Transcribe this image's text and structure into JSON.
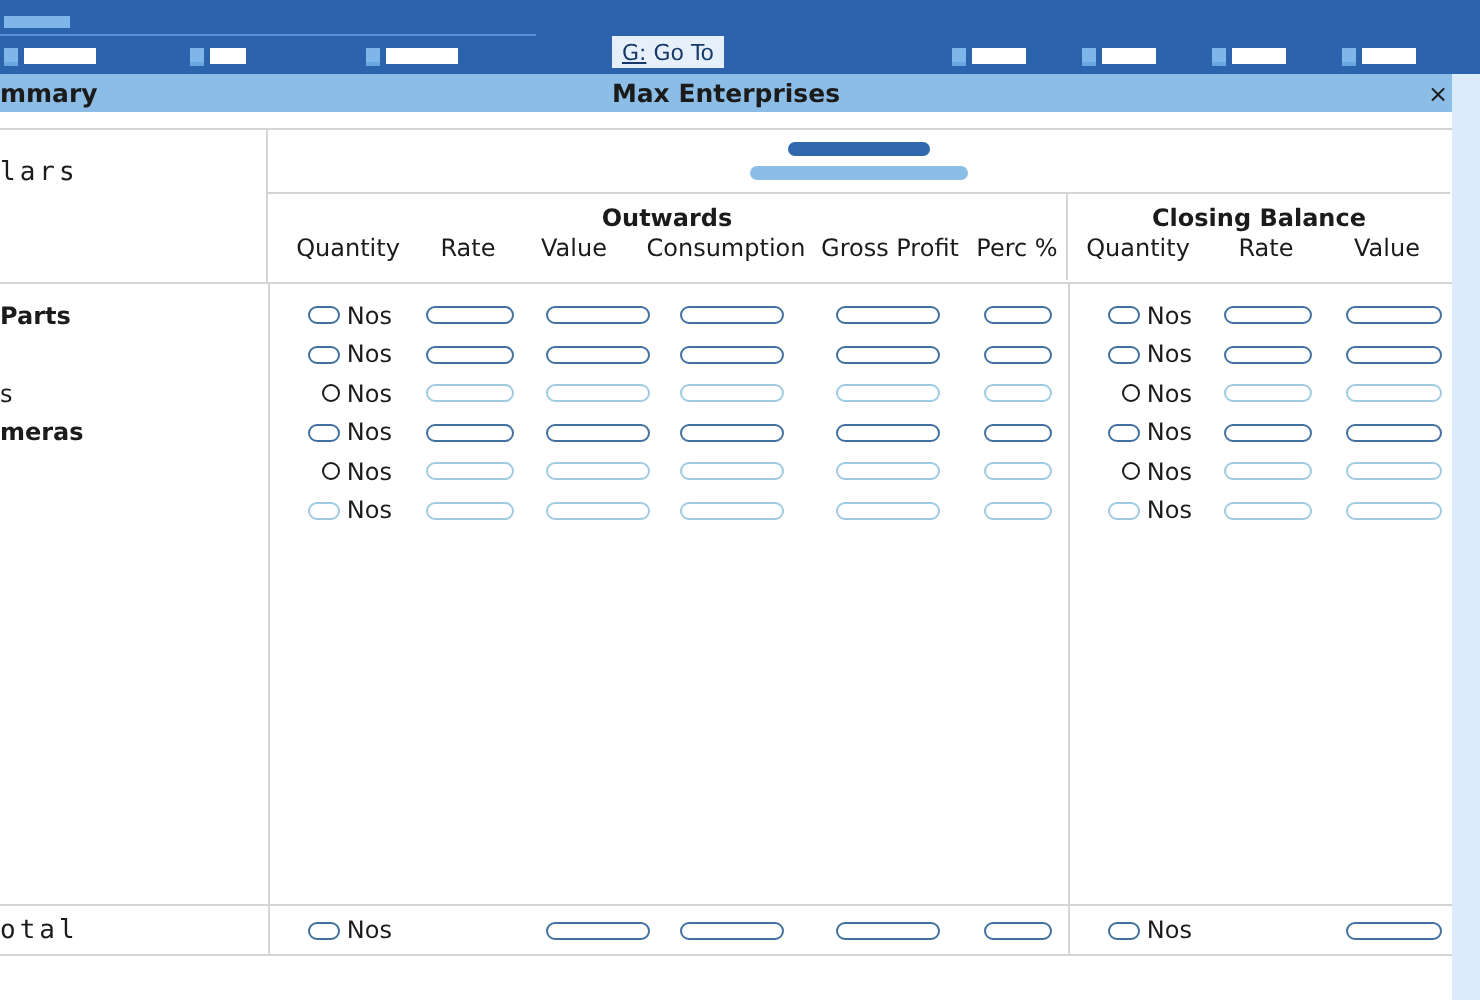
{
  "toolbar": {
    "goto_button": {
      "key": "G:",
      "label": "Go To"
    }
  },
  "title_bar": {
    "left": "mmary",
    "title": "Max Enterprises",
    "close": "×"
  },
  "report": {
    "particulars_heading": "lars",
    "groups": [
      {
        "title": "Outwards",
        "columns": [
          "Quantity",
          "Rate",
          "Value",
          "Consumption",
          "Gross Profit",
          "Perc %"
        ]
      },
      {
        "title": "Closing Balance",
        "columns": [
          "Quantity",
          "Rate",
          "Value"
        ]
      }
    ],
    "rows": [
      {
        "label": "Parts",
        "bold": true,
        "dimmed": false,
        "dot_marker": false,
        "outward_unit": "Nos",
        "closing_unit": "Nos"
      },
      {
        "dimmed": false,
        "dot_marker": false,
        "outward_unit": "Nos",
        "closing_unit": "Nos"
      },
      {
        "label": "s",
        "bold": false,
        "dimmed": true,
        "dot_marker": true,
        "outward_unit": "Nos",
        "closing_unit": "Nos"
      },
      {
        "label": "meras",
        "bold": true,
        "dimmed": false,
        "dot_marker": false,
        "outward_unit": "Nos",
        "closing_unit": "Nos"
      },
      {
        "dimmed": true,
        "dot_marker": true,
        "outward_unit": "Nos",
        "closing_unit": "Nos"
      },
      {
        "dimmed": true,
        "dot_marker": false,
        "outward_unit": "Nos",
        "closing_unit": "Nos"
      }
    ],
    "total": {
      "label": "otal",
      "outward_unit": "Nos",
      "closing_unit": "Nos",
      "filled": [
        false,
        true,
        true,
        true,
        true,
        false,
        true
      ]
    }
  }
}
